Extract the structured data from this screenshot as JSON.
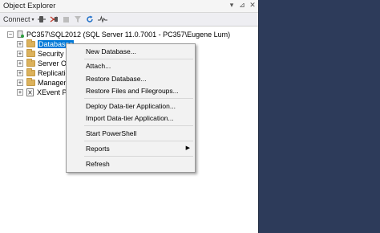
{
  "object_explorer": {
    "title": "Object Explorer",
    "controls": {
      "dropdown": "▾",
      "pin": "⊿",
      "close": "✕"
    }
  },
  "toolbar": {
    "connect_label": "Connect",
    "connect_caret": "▾",
    "connect_db_icon": "connect-database-icon",
    "disconnect_icon": "disconnect-icon",
    "stop_icon": "stop-icon",
    "filter_icon": "filter-icon",
    "refresh_icon": "refresh-icon",
    "activity_monitor_icon": "activity-monitor-icon"
  },
  "tree": {
    "server_expander": "−",
    "server_label": "PC357\\SQL2012 (SQL Server 11.0.7001 - PC357\\Eugene Lum)",
    "item_expander": "+",
    "items": [
      {
        "label": "Databases",
        "selected": true
      },
      {
        "label": "Security"
      },
      {
        "label": "Server Ob"
      },
      {
        "label": "Replicatio"
      },
      {
        "label": "Managem"
      },
      {
        "label": "XEvent Pr",
        "icon": "xevent-icon"
      }
    ]
  },
  "context_menu": {
    "items": [
      {
        "label": "New Database..."
      },
      {
        "label": "Attach..."
      },
      {
        "label": "Restore Database..."
      },
      {
        "label": "Restore Files and Filegroups..."
      },
      {
        "label": "Deploy Data-tier Application..."
      },
      {
        "label": "Import Data-tier Application..."
      },
      {
        "label": "Start PowerShell"
      },
      {
        "label": "Reports",
        "submenu_arrow": "▶"
      },
      {
        "label": "Refresh"
      }
    ]
  },
  "colors": {
    "selection": "#0078d7",
    "background": "#2d3b5a",
    "folder": "#dcb25c"
  }
}
